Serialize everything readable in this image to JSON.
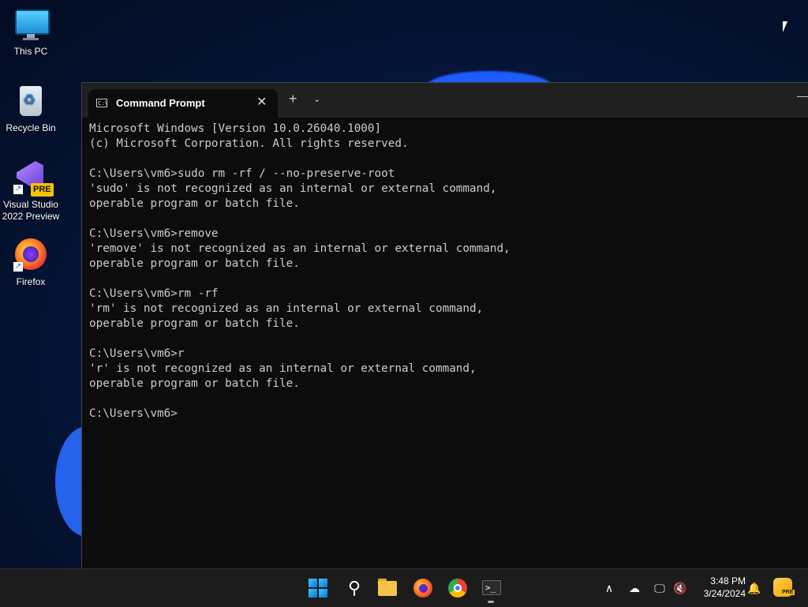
{
  "desktop": {
    "icons": [
      {
        "label": "This PC"
      },
      {
        "label": "Recycle Bin"
      },
      {
        "label": "Visual Studio\n2022 Preview",
        "badge": "PRE"
      },
      {
        "label": "Firefox"
      }
    ]
  },
  "window": {
    "tab_title": "Command Prompt",
    "tab_icon_text": "C:\\",
    "close_glyph": "✕",
    "new_tab_glyph": "+",
    "dropdown_glyph": "⌄",
    "minimize_glyph": "—"
  },
  "console": {
    "lines": [
      "Microsoft Windows [Version 10.0.26040.1000]",
      "(c) Microsoft Corporation. All rights reserved.",
      "",
      "C:\\Users\\vm6>sudo rm -rf / --no-preserve-root",
      "'sudo' is not recognized as an internal or external command,",
      "operable program or batch file.",
      "",
      "C:\\Users\\vm6>remove",
      "'remove' is not recognized as an internal or external command,",
      "operable program or batch file.",
      "",
      "C:\\Users\\vm6>rm -rf",
      "'rm' is not recognized as an internal or external command,",
      "operable program or batch file.",
      "",
      "C:\\Users\\vm6>r",
      "'r' is not recognized as an internal or external command,",
      "operable program or batch file.",
      "",
      "C:\\Users\\vm6>"
    ]
  },
  "taskbar": {
    "search_glyph": "⚲",
    "terminal_glyph": ">_",
    "tray": {
      "chevron_glyph": "∧",
      "time": "3:48 PM",
      "date": "3/24/2024",
      "copilot_badge": "PRE"
    }
  }
}
